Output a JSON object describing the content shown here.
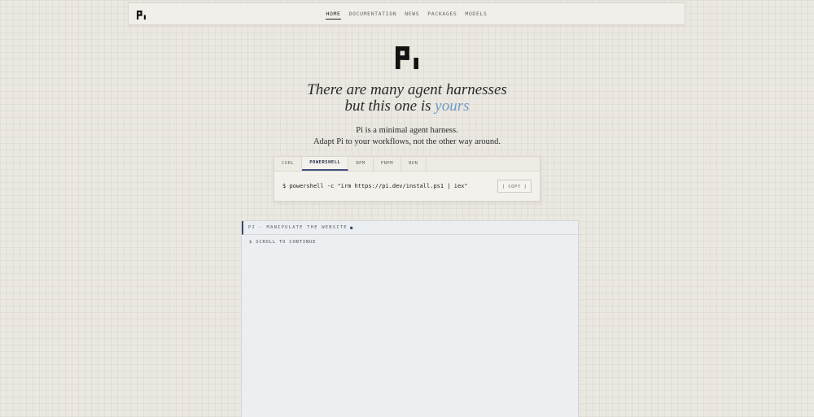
{
  "nav": {
    "logo_icon": "pi-logo-icon",
    "links": [
      {
        "label": "HOME",
        "active": true
      },
      {
        "label": "DOCUMENTATION",
        "active": false
      },
      {
        "label": "NEWS",
        "active": false
      },
      {
        "label": "PACKAGES",
        "active": false
      },
      {
        "label": "MODELS",
        "active": false
      }
    ]
  },
  "hero": {
    "logo_icon": "pi-logo-icon",
    "headline_line1": "There are many agent harnesses",
    "headline_line2_prefix": "but this one is",
    "headline_line2_accent": "yours",
    "subhead_line1": "Pi is a minimal agent harness.",
    "subhead_line2": "Adapt Pi to your workflows, not the other way around."
  },
  "install": {
    "tabs": [
      {
        "label": "CURL",
        "active": false
      },
      {
        "label": "POWERSHELL",
        "active": true
      },
      {
        "label": "NPM",
        "active": false
      },
      {
        "label": "PNPM",
        "active": false
      },
      {
        "label": "BUN",
        "active": false
      }
    ],
    "prompt": "$",
    "command": "powershell -c \"irm https://pi.dev/install.ps1 | iex\"",
    "copy_label": "[ COPY ]"
  },
  "terminal": {
    "title": "PI - MANIPULATE THE WEBSITE",
    "status_dot": "●",
    "line": "$ SCROLL TO CONTINUE"
  },
  "colors": {
    "accent": "#6f9cc6",
    "active_tab": "#40507a",
    "background": "#ebe7e1"
  }
}
